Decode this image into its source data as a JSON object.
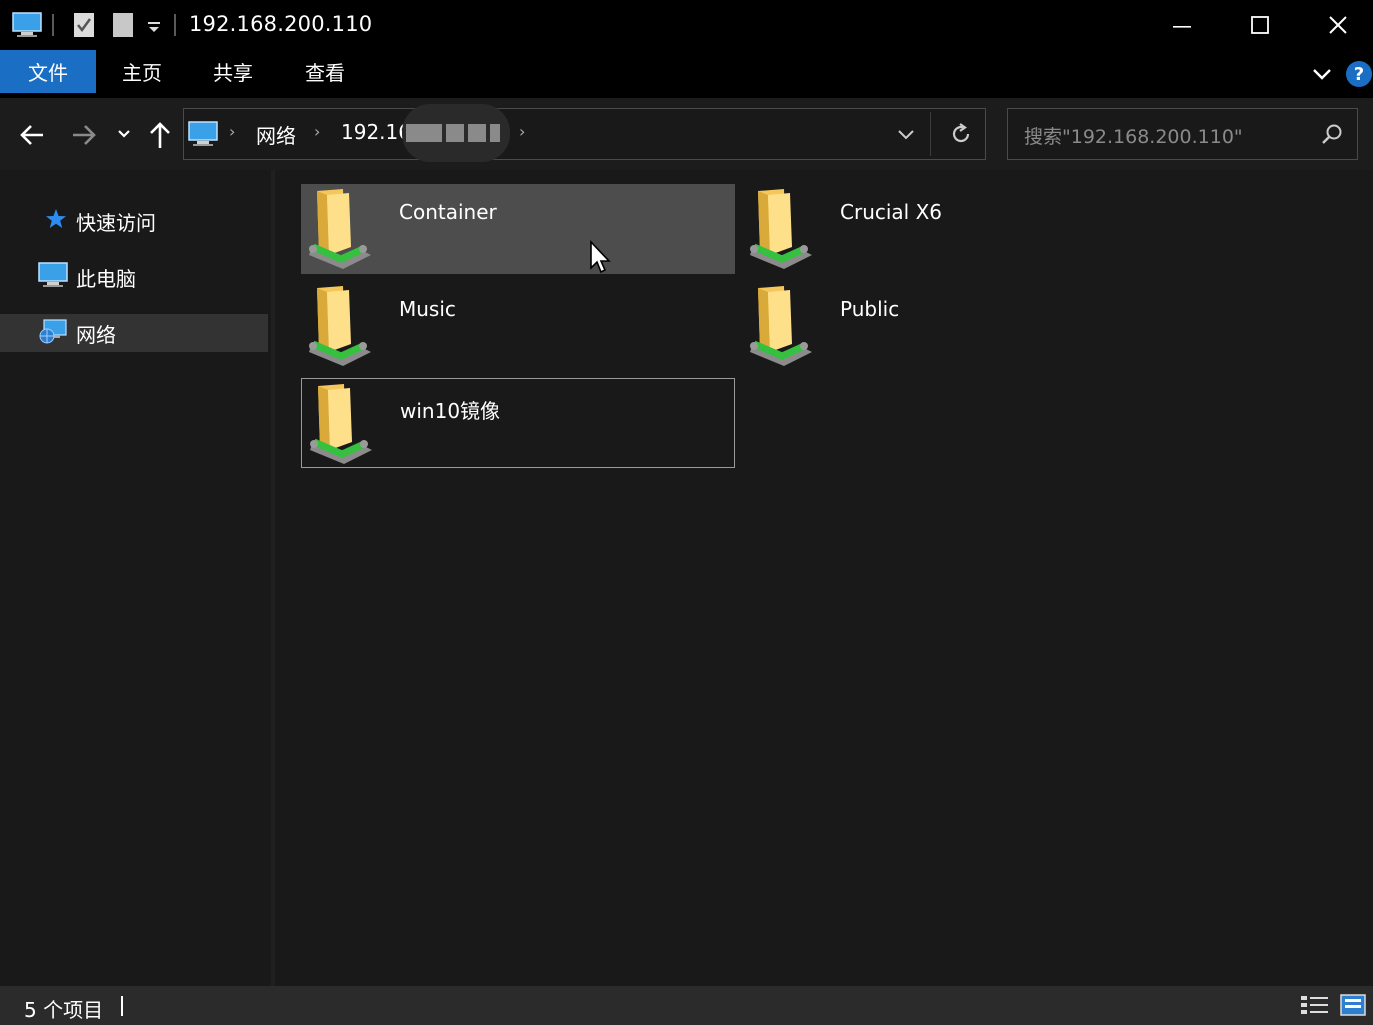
{
  "window": {
    "title": "192.168.200.110",
    "qat_icons": [
      "computer-icon",
      "properties-icon",
      "new-folder-icon",
      "customize-qat-icon"
    ],
    "controls": [
      "minimize-icon",
      "maximize-icon",
      "close-icon"
    ]
  },
  "ribbon": {
    "tabs": [
      {
        "label": "文件",
        "active": true
      },
      {
        "label": "主页"
      },
      {
        "label": "共享"
      },
      {
        "label": "查看"
      }
    ],
    "help_label": "?"
  },
  "nav": {
    "breadcrumb": [
      "网络",
      "192.16"
    ],
    "search_placeholder": "搜索\"192.168.200.110\""
  },
  "sidebar": {
    "items": [
      {
        "label": "快速访问",
        "icon": "star-icon"
      },
      {
        "label": "此电脑",
        "icon": "computer-icon"
      },
      {
        "label": "网络",
        "icon": "network-icon",
        "selected": true
      }
    ]
  },
  "content": {
    "items": [
      {
        "label": "Container",
        "state": "hover"
      },
      {
        "label": "Crucial X6"
      },
      {
        "label": "Music"
      },
      {
        "label": "Public"
      },
      {
        "label": "win10镜像",
        "state": "focus"
      }
    ]
  },
  "status": {
    "item_count": "5 个项目"
  },
  "colors": {
    "accent": "#1a6fc4",
    "background": "#191919",
    "hover": "#4d4d4d"
  }
}
